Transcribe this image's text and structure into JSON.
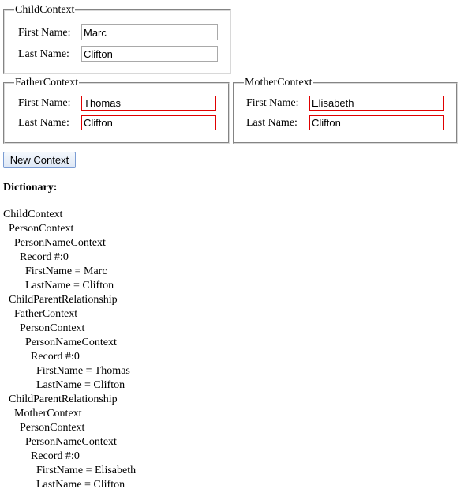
{
  "child": {
    "legend": "ChildContext",
    "first_label": "First Name:",
    "first_value": "Marc",
    "last_label": "Last Name:",
    "last_value": "Clifton"
  },
  "father": {
    "legend": "FatherContext",
    "first_label": "First Name:",
    "first_value": "Thomas",
    "last_label": "Last Name:",
    "last_value": "Clifton"
  },
  "mother": {
    "legend": "MotherContext",
    "first_label": "First Name:",
    "first_value": "Elisabeth",
    "last_label": "Last Name:",
    "last_value": "Clifton"
  },
  "new_context_button": "New Context",
  "dictionary_title": "Dictionary:",
  "dictionary_lines": [
    "ChildContext",
    "  PersonContext",
    "    PersonNameContext",
    "      Record #:0",
    "        FirstName = Marc",
    "        LastName = Clifton",
    "  ChildParentRelationship",
    "    FatherContext",
    "      PersonContext",
    "        PersonNameContext",
    "          Record #:0",
    "            FirstName = Thomas",
    "            LastName = Clifton",
    "  ChildParentRelationship",
    "    MotherContext",
    "      PersonContext",
    "        PersonNameContext",
    "          Record #:0",
    "            FirstName = Elisabeth",
    "            LastName = Clifton"
  ],
  "colors": {
    "invalid_border": "#e00000",
    "button_border": "#7a9cd3"
  }
}
